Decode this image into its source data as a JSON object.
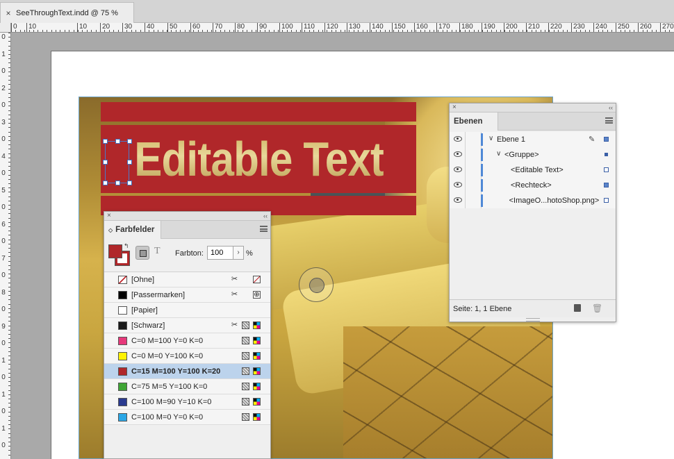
{
  "document_tab": {
    "close_glyph": "×",
    "title": "SeeThroughText.indd @ 75 %"
  },
  "ruler": {
    "h_labels": [
      "0",
      "10",
      "10",
      "20",
      "30",
      "40",
      "50",
      "60",
      "70",
      "80",
      "90",
      "100",
      "110",
      "120",
      "130",
      "140",
      "150",
      "160",
      "170",
      "180",
      "190",
      "200",
      "210",
      "220",
      "230",
      "240",
      "250",
      "260",
      "270"
    ],
    "v_labels": [
      "0",
      "1",
      "0",
      "2",
      "0",
      "3",
      "0",
      "4",
      "0",
      "5",
      "0",
      "6",
      "0",
      "7",
      "0",
      "8",
      "0",
      "9",
      "0",
      "1",
      "0",
      "1",
      "0",
      "1",
      "0"
    ]
  },
  "canvas": {
    "headline_text": "Editable Text",
    "red_color": "#b0272a"
  },
  "swatches_panel": {
    "close_glyph": "×",
    "collapse_glyph": "‹‹",
    "tab_arrows": "◇",
    "tab_label": "Farbfelder",
    "text_toggle": "T",
    "swap_glyph": "↰",
    "tint_label": "Farbton:",
    "tint_value": "100",
    "tint_step_glyph": "›",
    "tint_unit": "%",
    "rows": [
      {
        "name": "[Ohne]",
        "chip": "none",
        "icon_a": "✂",
        "icon_b": "",
        "icon_c": "none",
        "selected": false
      },
      {
        "name": "[Passermarken]",
        "chip": "#000000",
        "icon_a": "✂",
        "icon_b": "",
        "icon_c": "registration",
        "selected": false
      },
      {
        "name": "[Papier]",
        "chip": "#ffffff",
        "icon_a": "",
        "icon_b": "",
        "icon_c": "",
        "selected": false
      },
      {
        "name": "[Schwarz]",
        "chip": "#1a1a1a",
        "icon_a": "✂",
        "icon_b": "process",
        "icon_c": "cmyk",
        "selected": false
      },
      {
        "name": "C=0 M=100 Y=0 K=0",
        "chip": "#e6387a",
        "icon_a": "",
        "icon_b": "process",
        "icon_c": "cmyk",
        "selected": false
      },
      {
        "name": "C=0 M=0 Y=100 K=0",
        "chip": "#fff200",
        "icon_a": "",
        "icon_b": "process",
        "icon_c": "cmyk",
        "selected": false
      },
      {
        "name": "C=15 M=100 Y=100 K=20",
        "chip": "#b0272a",
        "icon_a": "",
        "icon_b": "process",
        "icon_c": "cmyk",
        "selected": true
      },
      {
        "name": "C=75 M=5 Y=100 K=0",
        "chip": "#3fa535",
        "icon_a": "",
        "icon_b": "process",
        "icon_c": "cmyk",
        "selected": false
      },
      {
        "name": "C=100 M=90 Y=10 K=0",
        "chip": "#2a3a8f",
        "icon_a": "",
        "icon_b": "process",
        "icon_c": "cmyk",
        "selected": false
      },
      {
        "name": "C=100 M=0 Y=0 K=0",
        "chip": "#2ba7e6",
        "icon_a": "",
        "icon_b": "process",
        "icon_c": "cmyk",
        "selected": false
      }
    ]
  },
  "layers_panel": {
    "close_glyph": "×",
    "collapse_glyph": "‹‹",
    "tab_label": "Ebenen",
    "rows": [
      {
        "name": "Ebene 1",
        "expand": "∨",
        "pen": "✎",
        "target": "filled",
        "level": 0
      },
      {
        "name": "<Gruppe>",
        "expand": "∨",
        "pen": "",
        "target": "small",
        "level": 1
      },
      {
        "name": "<Editable Text>",
        "expand": "",
        "pen": "",
        "target": "empty",
        "level": 2
      },
      {
        "name": "<Rechteck>",
        "expand": "",
        "pen": "",
        "target": "filled",
        "level": 2
      },
      {
        "name": "<ImageO...hotoShop.png>",
        "expand": "",
        "pen": "",
        "target": "empty",
        "level": 1.6
      }
    ],
    "status": "Seite: 1, 1 Ebene",
    "trash_glyph": "🗑"
  }
}
